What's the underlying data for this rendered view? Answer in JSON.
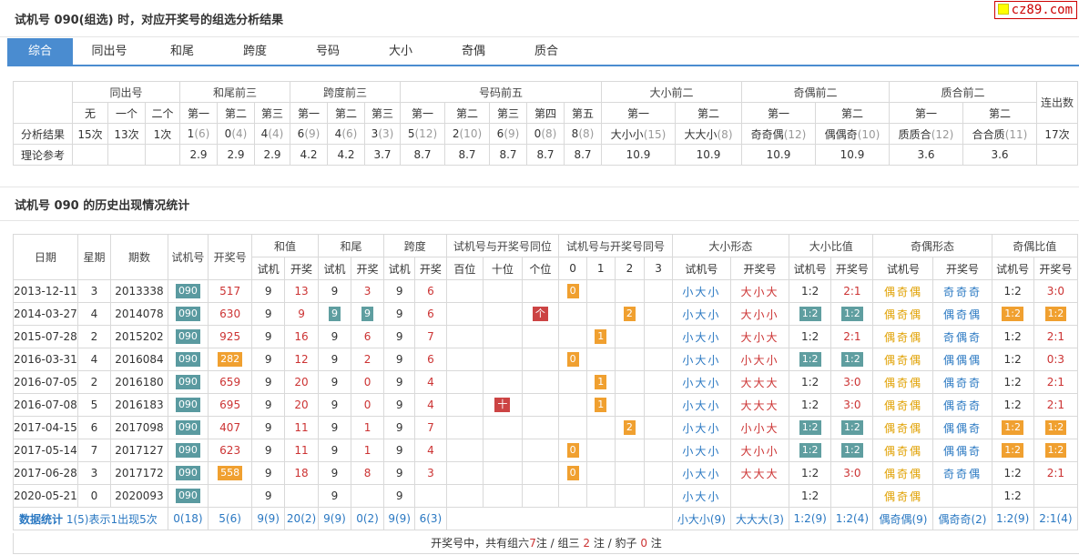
{
  "header": {
    "title": "试机号 090(组选) 时，对应开奖号的组选分析结果",
    "logo": "cz89.com"
  },
  "tabs": [
    "综合",
    "同出号",
    "和尾",
    "跨度",
    "号码",
    "大小",
    "奇偶",
    "质合"
  ],
  "summary": {
    "groups": [
      "同出号",
      "和尾前三",
      "跨度前三",
      "号码前五",
      "大小前二",
      "奇偶前二",
      "质合前二",
      "连出数"
    ],
    "subs": [
      "无",
      "一个",
      "二个",
      "第一",
      "第二",
      "第三",
      "第一",
      "第二",
      "第三",
      "第一",
      "第二",
      "第三",
      "第四",
      "第五",
      "第一",
      "第二",
      "第一",
      "第二",
      "第一",
      "第二"
    ],
    "row_labels": [
      "分析结果",
      "理论参考"
    ],
    "result": [
      "15次",
      "13次",
      "1次",
      "1",
      "(6)",
      "0",
      "(4)",
      "4",
      "(4)",
      "6",
      "(9)",
      "4",
      "(6)",
      "3",
      "(3)",
      "5",
      "(12)",
      "2",
      "(10)",
      "6",
      "(9)",
      "0",
      "(8)",
      "8",
      "(8)",
      "大小小",
      "(15)",
      "大大小",
      "(8)",
      "奇奇偶",
      "(12)",
      "偶偶奇",
      "(10)",
      "质质合",
      "(12)",
      "合合质",
      "(11)",
      "17次"
    ],
    "ref": [
      "2.9",
      "2.9",
      "2.9",
      "4.2",
      "4.2",
      "3.7",
      "8.7",
      "8.7",
      "8.7",
      "8.7",
      "8.7",
      "10.9",
      "10.9",
      "10.9",
      "10.9",
      "3.6",
      "3.6"
    ]
  },
  "history": {
    "title": "试机号 090 的历史出现情况统计",
    "h": {
      "date": "日期",
      "week": "星期",
      "period": "期数",
      "trial": "试机号",
      "draw": "开奖号",
      "sum": "和值",
      "tail": "和尾",
      "span": "跨度",
      "same_pos": "试机号与开奖号同位",
      "same_num": "试机号与开奖号同号",
      "size_shape": "大小形态",
      "size_ratio": "大小比值",
      "odd_shape": "奇偶形态",
      "odd_ratio": "奇偶比值",
      "s_trial": "试机",
      "s_draw": "开奖",
      "s_trial_no": "试机号",
      "s_draw_no": "开奖号",
      "hundreds": "百位",
      "tens": "十位",
      "ones": "个位",
      "n0": "0",
      "n1": "1",
      "n2": "2",
      "n3": "3"
    },
    "rows": [
      {
        "date": "2013-12-11",
        "week": "3",
        "period": "2013338",
        "trial": "090",
        "draw": "517",
        "sum_t": "9",
        "sum_d": "13",
        "tail_t": "9",
        "tail_d": "3",
        "span_t": "9",
        "span_d": "6",
        "pos": "",
        "same": "0",
        "ss_t": "小大小",
        "ss_d": "大小大",
        "sr_t": "1:2",
        "sr_d": "2:1",
        "os_t": "偶奇偶",
        "os_d": "奇奇奇",
        "or_t": "1:2",
        "or_d": "3:0"
      },
      {
        "date": "2014-03-27",
        "week": "4",
        "period": "2014078",
        "trial": "090",
        "draw": "630",
        "sum_t": "9",
        "sum_d": "9",
        "tail_t": "9",
        "tail_d": "9",
        "span_t": "9",
        "span_d": "6",
        "pos": "个",
        "same": "2",
        "ss_t": "小大小",
        "ss_d": "大小小",
        "sr_t": "1:2",
        "sr_d": "1:2",
        "os_t": "偶奇偶",
        "os_d": "偶奇偶",
        "or_t": "1:2",
        "or_d": "1:2"
      },
      {
        "date": "2015-07-28",
        "week": "2",
        "period": "2015202",
        "trial": "090",
        "draw": "925",
        "sum_t": "9",
        "sum_d": "16",
        "tail_t": "9",
        "tail_d": "6",
        "span_t": "9",
        "span_d": "7",
        "pos": "",
        "same": "1",
        "ss_t": "小大小",
        "ss_d": "大小大",
        "sr_t": "1:2",
        "sr_d": "2:1",
        "os_t": "偶奇偶",
        "os_d": "奇偶奇",
        "or_t": "1:2",
        "or_d": "2:1"
      },
      {
        "date": "2016-03-31",
        "week": "4",
        "period": "2016084",
        "trial": "090",
        "draw": "282",
        "sum_t": "9",
        "sum_d": "12",
        "tail_t": "9",
        "tail_d": "2",
        "span_t": "9",
        "span_d": "6",
        "pos": "",
        "same": "0",
        "ss_t": "小大小",
        "ss_d": "小大小",
        "sr_t": "1:2",
        "sr_d": "1:2",
        "os_t": "偶奇偶",
        "os_d": "偶偶偶",
        "or_t": "1:2",
        "or_d": "0:3"
      },
      {
        "date": "2016-07-05",
        "week": "2",
        "period": "2016180",
        "trial": "090",
        "draw": "659",
        "sum_t": "9",
        "sum_d": "20",
        "tail_t": "9",
        "tail_d": "0",
        "span_t": "9",
        "span_d": "4",
        "pos": "",
        "same": "1",
        "ss_t": "小大小",
        "ss_d": "大大大",
        "sr_t": "1:2",
        "sr_d": "3:0",
        "os_t": "偶奇偶",
        "os_d": "偶奇奇",
        "or_t": "1:2",
        "or_d": "2:1"
      },
      {
        "date": "2016-07-08",
        "week": "5",
        "period": "2016183",
        "trial": "090",
        "draw": "695",
        "sum_t": "9",
        "sum_d": "20",
        "tail_t": "9",
        "tail_d": "0",
        "span_t": "9",
        "span_d": "4",
        "pos": "十",
        "same": "1",
        "ss_t": "小大小",
        "ss_d": "大大大",
        "sr_t": "1:2",
        "sr_d": "3:0",
        "os_t": "偶奇偶",
        "os_d": "偶奇奇",
        "or_t": "1:2",
        "or_d": "2:1"
      },
      {
        "date": "2017-04-15",
        "week": "6",
        "period": "2017098",
        "trial": "090",
        "draw": "407",
        "sum_t": "9",
        "sum_d": "11",
        "tail_t": "9",
        "tail_d": "1",
        "span_t": "9",
        "span_d": "7",
        "pos": "",
        "same": "2",
        "ss_t": "小大小",
        "ss_d": "小小大",
        "sr_t": "1:2",
        "sr_d": "1:2",
        "os_t": "偶奇偶",
        "os_d": "偶偶奇",
        "or_t": "1:2",
        "or_d": "1:2"
      },
      {
        "date": "2017-05-14",
        "week": "7",
        "period": "2017127",
        "trial": "090",
        "draw": "623",
        "sum_t": "9",
        "sum_d": "11",
        "tail_t": "9",
        "tail_d": "1",
        "span_t": "9",
        "span_d": "4",
        "pos": "",
        "same": "0",
        "ss_t": "小大小",
        "ss_d": "大小小",
        "sr_t": "1:2",
        "sr_d": "1:2",
        "os_t": "偶奇偶",
        "os_d": "偶偶奇",
        "or_t": "1:2",
        "or_d": "1:2"
      },
      {
        "date": "2017-06-28",
        "week": "3",
        "period": "2017172",
        "trial": "090",
        "draw": "558",
        "sum_t": "9",
        "sum_d": "18",
        "tail_t": "9",
        "tail_d": "8",
        "span_t": "9",
        "span_d": "3",
        "pos": "",
        "same": "0",
        "ss_t": "小大小",
        "ss_d": "大大大",
        "sr_t": "1:2",
        "sr_d": "3:0",
        "os_t": "偶奇偶",
        "os_d": "奇奇偶",
        "or_t": "1:2",
        "or_d": "2:1"
      },
      {
        "date": "2020-05-21",
        "week": "0",
        "period": "2020093",
        "trial": "090",
        "draw": "",
        "sum_t": "9",
        "sum_d": "",
        "tail_t": "9",
        "tail_d": "",
        "span_t": "9",
        "span_d": "",
        "pos": "",
        "same": "",
        "ss_t": "小大小",
        "ss_d": "",
        "sr_t": "1:2",
        "sr_d": "",
        "os_t": "偶奇偶",
        "os_d": "",
        "or_t": "1:2",
        "or_d": ""
      }
    ],
    "stats": {
      "label": "数据统计",
      "note": "1(5)表示1出现5次",
      "trial": "0(18)",
      "draw": "5(6)",
      "sum_t": "9(9)",
      "sum_d": "20(2)",
      "tail_t": "9(9)",
      "tail_d": "0(2)",
      "span_t": "9(9)",
      "span_d": "6(3)",
      "ss_t": "小大小(9)",
      "ss_d": "大大大(3)",
      "sr_t": "1:2(9)",
      "sr_d": "1:2(4)",
      "os_t": "偶奇偶(9)",
      "os_d": "偶奇奇(2)",
      "or_t": "1:2(9)",
      "or_d": "2:1(4)"
    },
    "footer": {
      "pre": "开奖号中，共有组六",
      "n6": "7",
      "mid1": "注 / 组三",
      "n3": "2",
      "mid2": "注 / 豹子",
      "n0": "0",
      "post": "注"
    }
  }
}
